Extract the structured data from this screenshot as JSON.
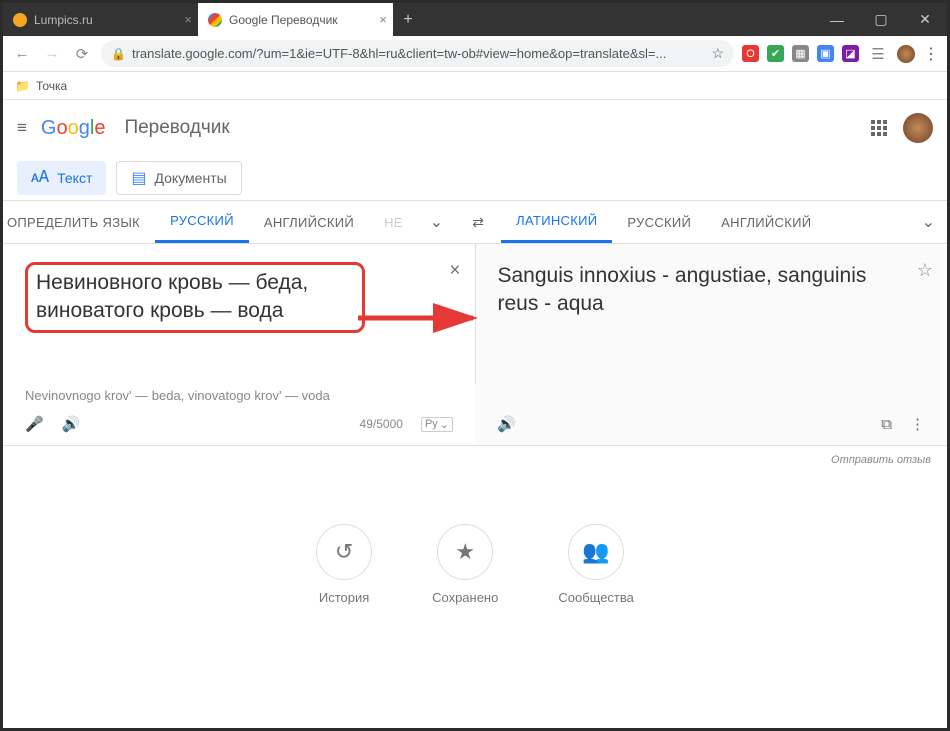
{
  "tabs": {
    "t0": "Lumpics.ru",
    "t1": "Google Переводчик"
  },
  "url": "translate.google.com/?um=1&ie=UTF-8&hl=ru&client=tw-ob#view=home&op=translate&sl=...",
  "bookmarks": {
    "b0": "Точка"
  },
  "brand": {
    "translator": "Переводчик"
  },
  "mode": {
    "text": "Текст",
    "docs": "Документы"
  },
  "lang": {
    "src0": "ОПРЕДЕЛИТЬ ЯЗЫК",
    "src1": "РУССКИЙ",
    "src2": "АНГЛИЙСКИЙ",
    "src3": "НЕ",
    "tgt0": "ЛАТИНСКИЙ",
    "tgt1": "РУССКИЙ",
    "tgt2": "АНГЛИЙСКИЙ"
  },
  "source_text": "Невиновного кровь — беда, виноватого кровь — вода",
  "translit": "Nevinovnogo krov' — beda, vinovatogo krov' — voda",
  "target_text": "Sanguis innoxius - angustiae, sanguinis reus - aqua",
  "char_count": "49/5000",
  "kbd_label": "Ру",
  "feedback": "Отправить отзыв",
  "bottom": {
    "history": "История",
    "saved": "Сохранено",
    "community": "Сообщества"
  }
}
